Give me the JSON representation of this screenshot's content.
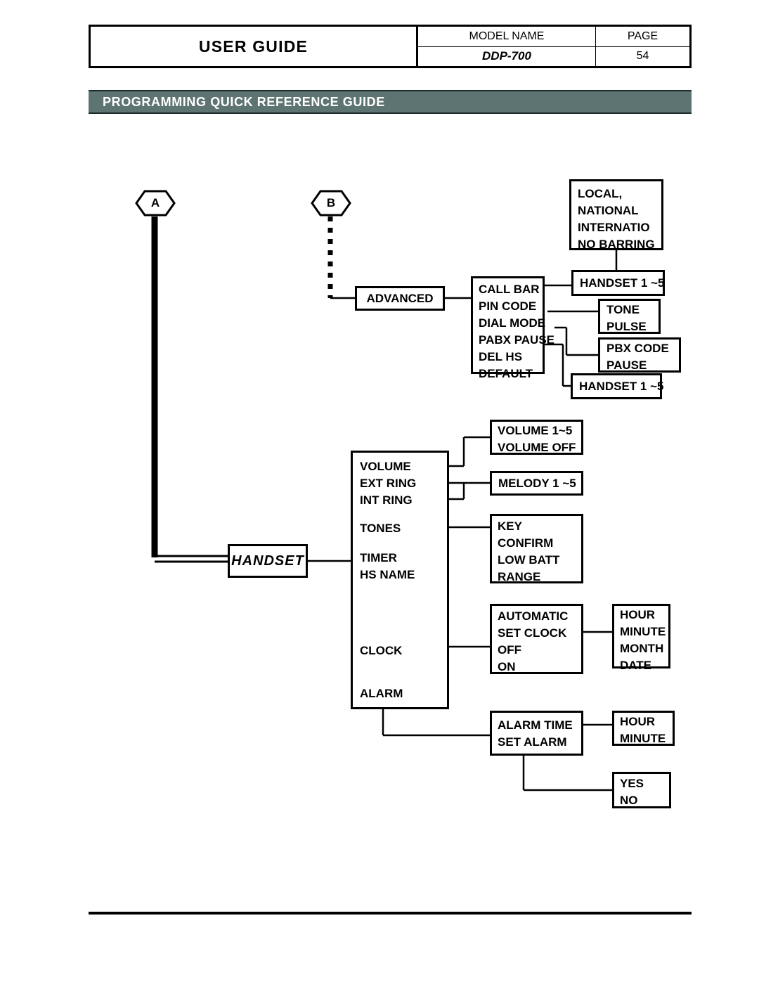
{
  "header": {
    "title": "USER GUIDE",
    "model_label": "MODEL NAME",
    "page_label": "PAGE",
    "model_value": "DDP-700",
    "page_value": "54"
  },
  "banner": {
    "title": "PROGRAMMING QUICK REFERENCE GUIDE"
  },
  "diagram": {
    "connector_a": "A",
    "connector_b": "B",
    "nodes": {
      "advanced": {
        "lines": [
          "ADVANCED"
        ]
      },
      "advanced_menu": {
        "lines": [
          "CALL BAR",
          "PIN CODE",
          "DIAL MODE",
          "PABX PAUSE",
          "DEL HS",
          "DEFAULT"
        ]
      },
      "call_bar_options": {
        "lines": [
          "LOCAL,",
          "NATIONAL",
          "INTERNATIO",
          "NO BARRING"
        ]
      },
      "handset_1_5_top": {
        "lines": [
          "HANDSET 1 ~5"
        ]
      },
      "dial_mode_options": {
        "lines": [
          "TONE",
          "PULSE"
        ]
      },
      "pabx_options": {
        "lines": [
          "PBX CODE",
          "PAUSE"
        ]
      },
      "handset_1_5_bottom": {
        "lines": [
          "HANDSET 1 ~5"
        ]
      },
      "handset": {
        "lines": [
          "HANDSET"
        ]
      },
      "handset_menu": {
        "lines": [
          "VOLUME",
          "EXT RING",
          "INT RING",
          "TONES",
          "TIMER",
          "HS NAME",
          "CLOCK",
          "ALARM"
        ]
      },
      "volume_options": {
        "lines": [
          "VOLUME 1~5",
          "VOLUME OFF"
        ]
      },
      "melody_options": {
        "lines": [
          "MELODY 1 ~5"
        ]
      },
      "tones_options": {
        "lines": [
          "KEY",
          "CONFIRM",
          "LOW BATT",
          "RANGE"
        ]
      },
      "clock_options": {
        "lines": [
          "AUTOMATIC",
          "SET CLOCK",
          "OFF",
          "ON"
        ]
      },
      "set_clock_fields": {
        "lines": [
          "HOUR",
          "MINUTE",
          "MONTH",
          "DATE"
        ]
      },
      "alarm_options": {
        "lines": [
          "ALARM TIME",
          "SET ALARM"
        ]
      },
      "alarm_time_fields": {
        "lines": [
          "HOUR",
          "MINUTE"
        ]
      },
      "set_alarm_fields": {
        "lines": [
          "YES",
          "NO"
        ]
      }
    }
  },
  "colors": {
    "banner_bg": "#5e7472",
    "banner_text": "#ffffff",
    "line": "#000000",
    "page_bg": "#ffffff"
  }
}
